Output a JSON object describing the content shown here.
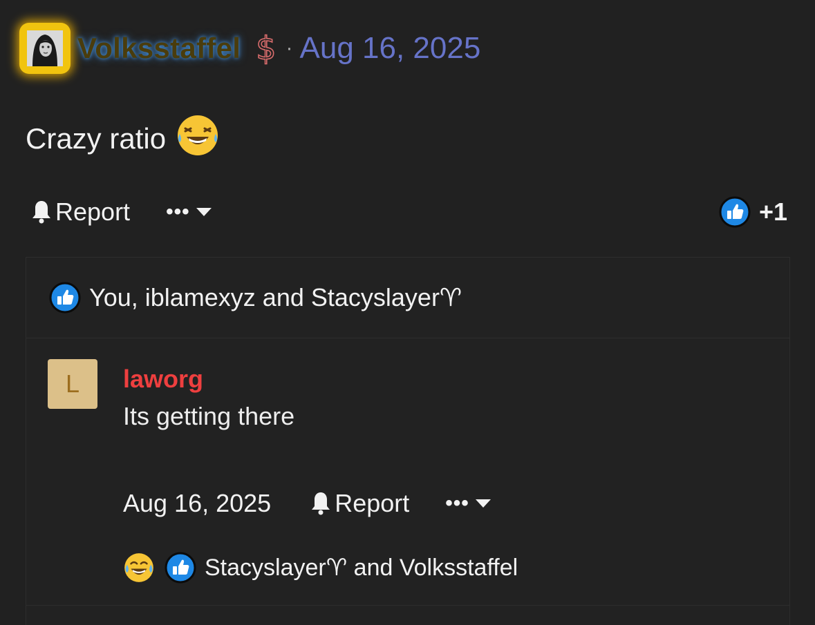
{
  "post": {
    "author": "Volksstaffel",
    "badge_icon": "dollar-sign-icon",
    "separator": "·",
    "date": "Aug 16, 2025",
    "text": "Crazy ratio",
    "text_emoji": "laughing-tears-face-icon"
  },
  "actions": {
    "report_label": "Report",
    "more_label": "•••",
    "reaction_count": "+1"
  },
  "likers": {
    "text": "You, iblamexyz and Stacyslayer♈"
  },
  "reply": {
    "avatar_letter": "L",
    "author": "laworg",
    "text": "Its getting there",
    "date": "Aug 16, 2025",
    "report_label": "Report",
    "more_label": "•••",
    "reactions_text": "Stacyslayer♈ and Volksstaffel"
  },
  "colors": {
    "background": "#212121",
    "date_link": "#6673c8",
    "reply_author": "#ee3f3f",
    "like_blue": "#1e88e5",
    "avatar_bg": "#dcc089"
  }
}
